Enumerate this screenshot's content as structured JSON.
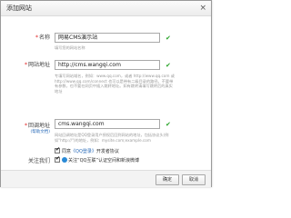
{
  "dialog": {
    "title": "添加网站",
    "close_glyph": "×"
  },
  "form": {
    "name": {
      "required_mark": "*",
      "label": "名称",
      "value": "网易CMS演示站",
      "hint": "填写您的网站名称"
    },
    "url": {
      "required_mark": "*",
      "label": "网站地址",
      "value": "http://cms.wangqi.com",
      "hint": "专填写网站域名，例如：www.qq.com，或者  http://www.qq.com 或 http://www.qq.com/connect 也可以是带有二级目录的路径。不要带有参数，也不要在网页中插入跳转地址。如有跳转请填写跳转后的真实地址"
    },
    "callback": {
      "required_mark": "*",
      "label": "回调地址",
      "sublabel": "(帮助文档)",
      "value": "cms.wangqi.com",
      "hint": "网站回调地址是QQ登录用户授权后回到网站的地址，包括协议头(例如\"http://\")的地址，例如：mysite.com;example.com"
    },
    "permissions": {
      "prefix_checked": "✔",
      "text_prefix": "同意",
      "link_text": "《QQ登录》",
      "text_suffix": "开发者协议"
    },
    "follow": {
      "label": "关注我们",
      "checked": "✔",
      "text": "关注“QQ互联”认证空间和新浪微博"
    },
    "valid_mark": "✔"
  },
  "footer": {
    "confirm_label": "确定",
    "cancel_label": "取消"
  },
  "colors": {
    "accent_link": "#2a6bb8",
    "valid_check": "#27a327",
    "required": "#e02020"
  },
  "icons": {
    "close": "close-icon",
    "check": "check-icon",
    "qq": "qq-logo-icon"
  }
}
